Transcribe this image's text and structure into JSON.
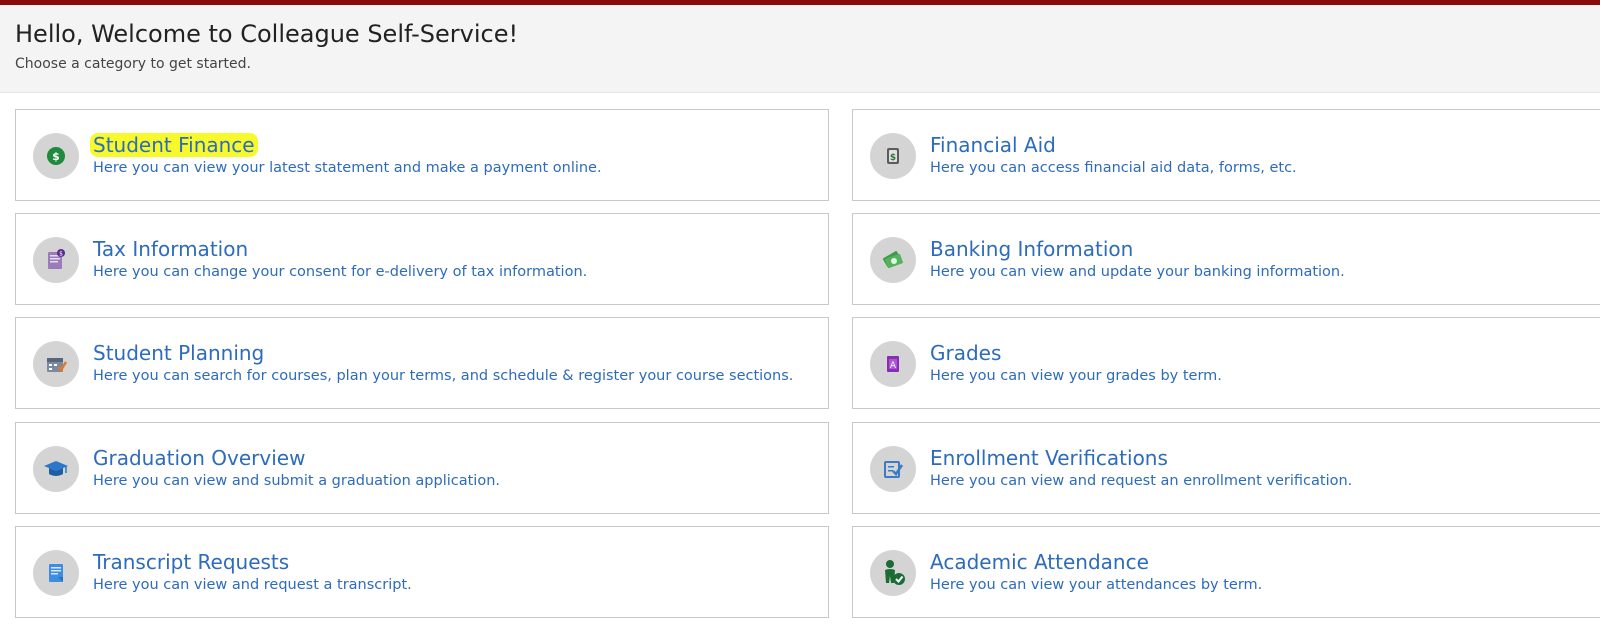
{
  "header": {
    "title": "Hello, Welcome to Colleague Self-Service!",
    "subtitle": "Choose a category to get started."
  },
  "colors": {
    "top_bar": "#8b0a0a",
    "link_blue": "#2d6bbd",
    "highlight": "#f7f92a",
    "icon_circle": "#d4d4d4"
  },
  "categories": [
    {
      "title": "Student Finance",
      "description": "Here you can view your latest statement and make a payment online.",
      "icon": "dollar-coin-icon",
      "highlighted": true
    },
    {
      "title": "Financial Aid",
      "description": "Here you can access financial aid data, forms, etc.",
      "icon": "financial-aid-document-icon",
      "highlighted": false
    },
    {
      "title": "Tax Information",
      "description": "Here you can change your consent for e-delivery of tax information.",
      "icon": "tax-document-icon",
      "highlighted": false
    },
    {
      "title": "Banking Information",
      "description": "Here you can view and update your banking information.",
      "icon": "money-bills-icon",
      "highlighted": false
    },
    {
      "title": "Student Planning",
      "description": "Here you can search for courses, plan your terms, and schedule & register your course sections.",
      "icon": "calendar-check-icon",
      "highlighted": false
    },
    {
      "title": "Grades",
      "description": "Here you can view your grades by term.",
      "icon": "grade-book-icon",
      "highlighted": false
    },
    {
      "title": "Graduation Overview",
      "description": "Here you can view and submit a graduation application.",
      "icon": "graduation-cap-icon",
      "highlighted": false
    },
    {
      "title": "Enrollment Verifications",
      "description": "Here you can view and request an enrollment verification.",
      "icon": "verification-form-icon",
      "highlighted": false
    },
    {
      "title": "Transcript Requests",
      "description": "Here you can view and request a transcript.",
      "icon": "transcript-document-icon",
      "highlighted": false
    },
    {
      "title": "Academic Attendance",
      "description": "Here you can view your attendances by term.",
      "icon": "person-check-icon",
      "highlighted": false
    }
  ]
}
